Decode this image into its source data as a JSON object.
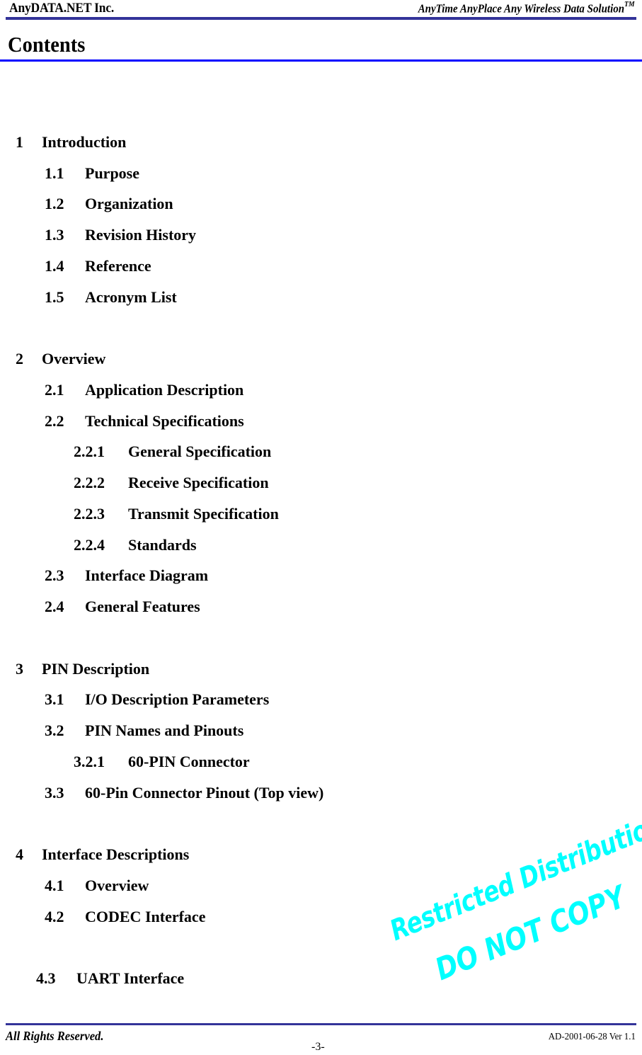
{
  "header": {
    "company": "AnyDATA.NET Inc.",
    "tagline": "AnyTime AnyPlace Any Wireless Data Solution",
    "tagline_superscript": "TM",
    "rule_color": "#333399"
  },
  "page_title": "Contents",
  "title_rule_color": "#0000ff",
  "toc": [
    {
      "num": "1",
      "title": "Introduction",
      "level": 1
    },
    {
      "num": "1.1",
      "title": "Purpose",
      "level": 2
    },
    {
      "num": "1.2",
      "title": "Organization",
      "level": 2
    },
    {
      "num": "1.3",
      "title": "Revision History",
      "level": 2
    },
    {
      "num": "1.4",
      "title": "Reference",
      "level": 2
    },
    {
      "num": "1.5",
      "title": "Acronym List",
      "level": 2
    },
    {
      "num": "2",
      "title": "Overview",
      "level": 1
    },
    {
      "num": "2.1",
      "title": "Application Description",
      "level": 2
    },
    {
      "num": "2.2",
      "title": "Technical Specifications",
      "level": 2
    },
    {
      "num": "2.2.1",
      "title": "General Specification",
      "level": 3
    },
    {
      "num": "2.2.2",
      "title": "Receive Specification",
      "level": 3
    },
    {
      "num": "2.2.3",
      "title": "Transmit Specification",
      "level": 3
    },
    {
      "num": "2.2.4",
      "title": "Standards",
      "level": 3
    },
    {
      "num": "2.3",
      "title": "Interface Diagram",
      "level": 2
    },
    {
      "num": "2.4",
      "title": "General Features",
      "level": 2
    },
    {
      "num": "3",
      "title": "PIN Description",
      "level": 1
    },
    {
      "num": "3.1",
      "title": "I/O Description Parameters",
      "level": 2
    },
    {
      "num": "3.2",
      "title": "PIN Names and Pinouts",
      "level": 2
    },
    {
      "num": "3.2.1",
      "title": "60-PIN Connector",
      "level": 3
    },
    {
      "num": "3.3",
      "title": "60-Pin Connector Pinout (Top view)",
      "level": 2
    },
    {
      "num": "4",
      "title": "Interface Descriptions",
      "level": 1
    },
    {
      "num": "4.1",
      "title": "Overview",
      "level": 2
    },
    {
      "num": "4.2",
      "title": "CODEC Interface",
      "level": 2
    },
    {
      "num": "4.3",
      "title": "UART Interface",
      "level": 2
    }
  ],
  "watermark": {
    "line1": "Restricted Distribution",
    "line2": "DO NOT COPY",
    "color": "#00ffff"
  },
  "footer": {
    "rights": "All Rights Reserved.",
    "doc_id": "AD-2001-06-28 Ver 1.1",
    "page_number": "-3-"
  }
}
